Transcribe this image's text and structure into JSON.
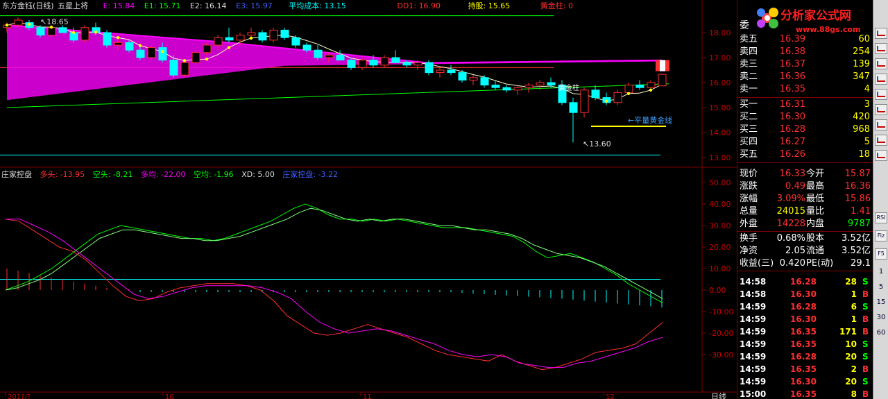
{
  "header": {
    "title": "东方金钰(日线)",
    "formula": "五星上将",
    "E": "E: 15.84",
    "E1": "E1: 15.71",
    "E2": "E2: 16.14",
    "E3": "E3: 15.97",
    "avg_cost": "平均成本: 13.15",
    "dd1": "DD1: 16.90",
    "hold": "持股: 15.65",
    "golden": "黄金柱: 0"
  },
  "sub_header": {
    "title": "庄家控盘",
    "duotou": "多头: -13.95",
    "kongtou": "空头: -8.21",
    "duojun": "多均: -22.00",
    "kongjun": "空均: -1.96",
    "xd": "XD: 5.00",
    "zjkp": "庄家控盘: -3.22"
  },
  "annotations": {
    "high": "18.65",
    "low": "13.60",
    "flat_line": "←平量黄金线",
    "golden_pillar": "黄金柱"
  },
  "price_axis": [
    "18.00",
    "17.00",
    "16.00",
    "15.00",
    "14.00",
    "13.00"
  ],
  "osc_axis": [
    "50.00",
    "40.00",
    "30.00",
    "20.00",
    "10.00",
    "0.00",
    "-10.00",
    "-20.00",
    "-30.00"
  ],
  "time_axis": [
    "201?/?",
    "10",
    "11",
    "12"
  ],
  "period_label": "日线",
  "logo": {
    "text": "分析家公式网",
    "url": "www.88gs.com"
  },
  "colors": {
    "up": "#ff3030",
    "down": "#00ffff",
    "magenta": "#ff00ff",
    "green": "#00ff00",
    "yellow": "#ffff00",
    "cyan": "#00ffff",
    "grid": "#800000",
    "axis_text": "#cc0000"
  },
  "order_book": {
    "sell": [
      {
        "label": "卖五",
        "price": "16.39",
        "vol": "60"
      },
      {
        "label": "卖四",
        "price": "16.38",
        "vol": "254"
      },
      {
        "label": "卖三",
        "price": "16.37",
        "vol": "139"
      },
      {
        "label": "卖二",
        "price": "16.36",
        "vol": "347"
      },
      {
        "label": "卖一",
        "price": "16.35",
        "vol": "4"
      }
    ],
    "buy": [
      {
        "label": "买一",
        "price": "16.31",
        "vol": "3"
      },
      {
        "label": "买二",
        "price": "16.30",
        "vol": "420"
      },
      {
        "label": "买三",
        "price": "16.28",
        "vol": "968"
      },
      {
        "label": "买四",
        "price": "16.27",
        "vol": "5"
      },
      {
        "label": "买五",
        "price": "16.26",
        "vol": "18"
      }
    ],
    "sell_header": "委"
  },
  "quote": [
    {
      "l1": "现价",
      "v1": "16.33",
      "l2": "今开",
      "v2": "15.87",
      "c1": "#ff3030",
      "c2": "#ff3030"
    },
    {
      "l1": "涨跌",
      "v1": "0.49",
      "l2": "最高",
      "v2": "16.36",
      "c1": "#ff3030",
      "c2": "#ff3030"
    },
    {
      "l1": "涨幅",
      "v1": "3.09%",
      "l2": "最低",
      "v2": "15.86",
      "c1": "#ff3030",
      "c2": "#ff3030"
    },
    {
      "l1": "总量",
      "v1": "24015",
      "l2": "量比",
      "v2": "1.41",
      "c1": "#ffff00",
      "c2": "#ff3030"
    },
    {
      "l1": "外盘",
      "v1": "14228",
      "l2": "内盘",
      "v2": "9787",
      "c1": "#ff3030",
      "c2": "#00ff00"
    },
    {
      "l1": "换手",
      "v1": "0.68%",
      "l2": "股本",
      "v2": "3.52亿",
      "c1": "#ffffff",
      "c2": "#ffffff"
    },
    {
      "l1": "净资",
      "v1": "2.05",
      "l2": "流通",
      "v2": "3.52亿",
      "c1": "#ffffff",
      "c2": "#ffffff"
    },
    {
      "l1": "收益(三)",
      "v1": "0.420",
      "l2": "PE(动)",
      "v2": "29.1",
      "c1": "#ffffff",
      "c2": "#ffffff"
    }
  ],
  "ticks": [
    {
      "time": "14:58",
      "price": "16.28",
      "vol": "28",
      "dir": "S"
    },
    {
      "time": "14:58",
      "price": "16.30",
      "vol": "1",
      "dir": "B"
    },
    {
      "time": "14:59",
      "price": "16.28",
      "vol": "6",
      "dir": "S"
    },
    {
      "time": "14:59",
      "price": "16.30",
      "vol": "1",
      "dir": "B"
    },
    {
      "time": "14:59",
      "price": "16.35",
      "vol": "171",
      "dir": "B"
    },
    {
      "time": "14:59",
      "price": "16.35",
      "vol": "10",
      "dir": "S"
    },
    {
      "time": "14:59",
      "price": "16.28",
      "vol": "20",
      "dir": "S"
    },
    {
      "time": "14:59",
      "price": "16.35",
      "vol": "2",
      "dir": "B"
    },
    {
      "time": "14:59",
      "price": "16.30",
      "vol": "20",
      "dir": "S"
    },
    {
      "time": "15:00",
      "price": "16.35",
      "vol": "8",
      "dir": "B"
    }
  ],
  "toolbar": [
    "RSI",
    "Fiz",
    "F5",
    "1",
    "5",
    "15",
    "30",
    "60"
  ],
  "candles": [
    [
      18.2,
      18.4,
      18.0,
      18.3
    ],
    [
      18.3,
      18.6,
      18.2,
      18.5
    ],
    [
      18.4,
      18.5,
      18.1,
      18.2
    ],
    [
      18.2,
      18.3,
      17.8,
      17.9
    ],
    [
      17.9,
      18.3,
      17.8,
      18.2
    ],
    [
      18.2,
      18.3,
      18.0,
      18.0
    ],
    [
      18.0,
      18.2,
      17.6,
      17.7
    ],
    [
      17.7,
      18.3,
      17.6,
      18.2
    ],
    [
      18.2,
      18.4,
      17.9,
      18.0
    ],
    [
      18.0,
      18.1,
      17.4,
      17.5
    ],
    [
      17.5,
      17.7,
      17.3,
      17.6
    ],
    [
      17.6,
      17.7,
      17.2,
      17.3
    ],
    [
      17.3,
      17.5,
      16.9,
      17.0
    ],
    [
      17.0,
      17.5,
      16.9,
      17.4
    ],
    [
      17.4,
      17.6,
      16.8,
      16.9
    ],
    [
      16.9,
      17.1,
      16.2,
      16.3
    ],
    [
      16.3,
      16.9,
      16.2,
      16.8
    ],
    [
      16.8,
      17.3,
      16.7,
      17.2
    ],
    [
      17.2,
      17.6,
      17.1,
      17.5
    ],
    [
      17.5,
      17.9,
      17.3,
      17.8
    ],
    [
      17.8,
      18.2,
      17.6,
      17.7
    ],
    [
      17.7,
      18.0,
      17.5,
      17.9
    ],
    [
      17.9,
      18.2,
      17.7,
      18.0
    ],
    [
      18.0,
      18.1,
      17.6,
      17.7
    ],
    [
      17.7,
      18.2,
      17.6,
      18.1
    ],
    [
      18.1,
      18.2,
      17.7,
      17.8
    ],
    [
      17.8,
      17.9,
      17.4,
      17.5
    ],
    [
      17.5,
      17.6,
      17.2,
      17.3
    ],
    [
      17.3,
      17.5,
      16.9,
      17.0
    ],
    [
      17.0,
      17.2,
      16.8,
      17.1
    ],
    [
      17.1,
      17.3,
      16.9,
      16.9
    ],
    [
      16.9,
      17.0,
      16.5,
      16.6
    ],
    [
      16.6,
      17.0,
      16.5,
      16.9
    ],
    [
      16.9,
      17.1,
      16.6,
      16.7
    ],
    [
      16.7,
      17.1,
      16.6,
      17.0
    ],
    [
      17.0,
      17.3,
      16.8,
      16.8
    ],
    [
      16.8,
      16.9,
      16.6,
      16.7
    ],
    [
      16.7,
      16.9,
      16.5,
      16.8
    ],
    [
      16.8,
      16.9,
      16.3,
      16.4
    ],
    [
      16.4,
      16.6,
      16.2,
      16.5
    ],
    [
      16.5,
      16.7,
      16.3,
      16.4
    ],
    [
      16.4,
      16.5,
      16.0,
      16.1
    ],
    [
      16.1,
      16.3,
      15.9,
      16.2
    ],
    [
      16.2,
      16.3,
      15.8,
      15.9
    ],
    [
      15.9,
      16.1,
      15.7,
      15.8
    ],
    [
      15.8,
      15.9,
      15.6,
      15.7
    ],
    [
      15.7,
      15.9,
      15.5,
      15.8
    ],
    [
      15.8,
      16.0,
      15.6,
      15.9
    ],
    [
      15.9,
      16.1,
      15.7,
      16.0
    ],
    [
      16.0,
      16.2,
      15.8,
      15.9
    ],
    [
      15.9,
      16.1,
      15.1,
      15.2
    ],
    [
      15.2,
      15.4,
      13.6,
      14.8
    ],
    [
      14.8,
      15.8,
      14.6,
      15.7
    ],
    [
      15.7,
      15.9,
      15.3,
      15.4
    ],
    [
      15.4,
      15.6,
      15.1,
      15.2
    ],
    [
      15.2,
      15.7,
      15.1,
      15.6
    ],
    [
      15.6,
      16.0,
      15.5,
      15.9
    ],
    [
      15.9,
      16.1,
      15.7,
      15.8
    ],
    [
      15.8,
      16.1,
      15.7,
      16.0
    ],
    [
      15.87,
      16.36,
      15.86,
      16.33
    ]
  ]
}
